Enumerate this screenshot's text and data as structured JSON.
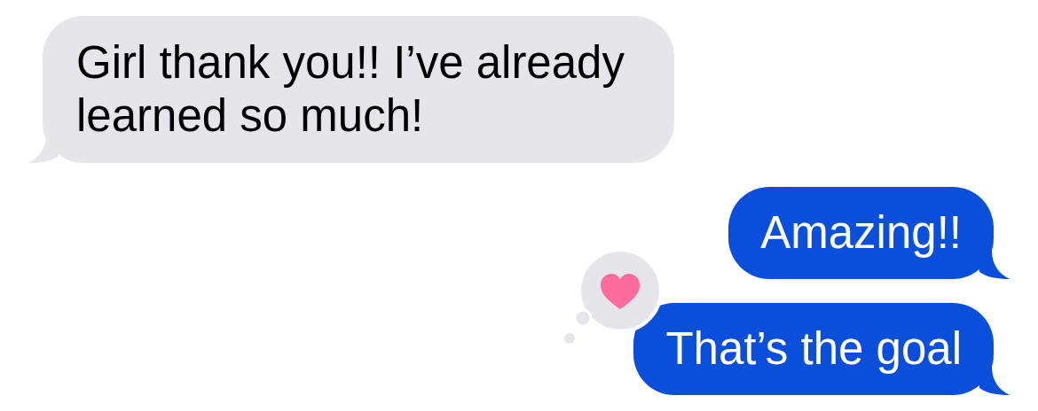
{
  "messages": [
    {
      "kind": "incoming",
      "text": "Girl thank you!! I’ve already learned so much!"
    },
    {
      "kind": "outgoing",
      "text": "Amazing!!"
    },
    {
      "kind": "outgoing",
      "text": "That’s the goal",
      "reaction": {
        "kind": "heart"
      }
    }
  ]
}
